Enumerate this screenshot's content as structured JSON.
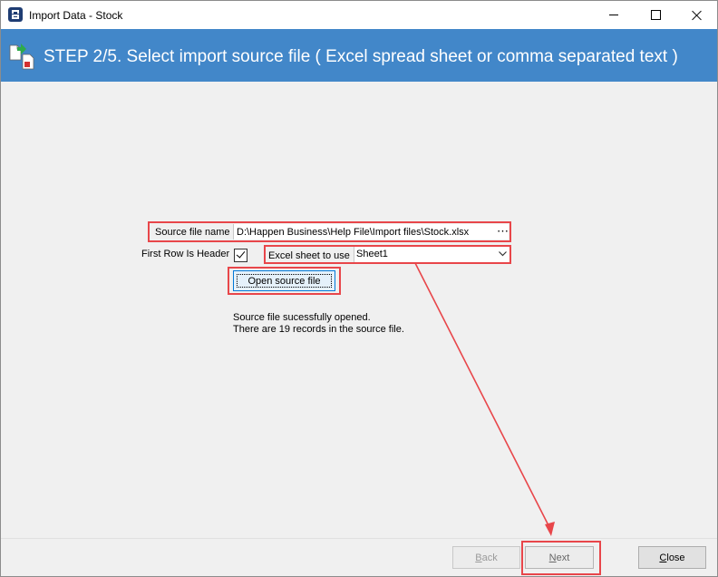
{
  "window": {
    "title": "Import Data - Stock"
  },
  "banner": {
    "title": "STEP 2/5. Select import source file ( Excel spread sheet or comma separated text )"
  },
  "form": {
    "source_file_label": "Source file name",
    "source_file_value": "D:\\Happen Business\\Help File\\Import files\\Stock.xlsx",
    "browse_glyph": "⋯",
    "first_row_header_label": "First Row Is Header",
    "first_row_header_checked": true,
    "excel_sheet_label": "Excel sheet to use",
    "excel_sheet_value": "Sheet1",
    "open_source_button": "Open source file",
    "status_line1": "Source file sucessfully opened.",
    "status_line2": "There are 19 records in the source file."
  },
  "footer": {
    "back_first": "B",
    "back_rest": "ack",
    "next_first": "N",
    "next_rest": "ext",
    "close_first": "C",
    "close_rest": "lose"
  },
  "colors": {
    "banner": "#4287c9",
    "highlight": "#e8464a"
  }
}
